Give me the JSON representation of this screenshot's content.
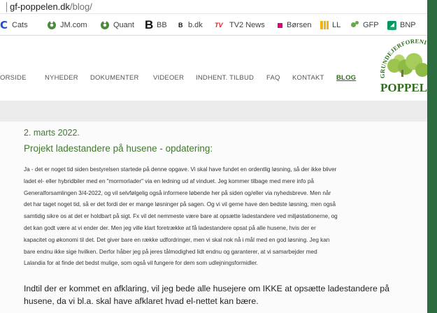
{
  "browser": {
    "url_domain": "gf-poppelen.dk",
    "url_path": "/blog/"
  },
  "bookmarks": [
    {
      "label": "Cats",
      "icon": "c-logo-icon"
    },
    {
      "label": "JM.com",
      "icon": "flower-icon"
    },
    {
      "label": "Quant",
      "icon": "flower-icon"
    },
    {
      "label": "BB",
      "icon": "b-logo-icon"
    },
    {
      "label": "b.dk",
      "icon": "b-logo-icon"
    },
    {
      "label": "TV2 News",
      "icon": "tv2-icon"
    },
    {
      "label": "Børsen",
      "icon": "square-icon"
    },
    {
      "label": "LL",
      "icon": "bars-icon"
    },
    {
      "label": "GFP",
      "icon": "leaf-icon"
    },
    {
      "label": "BNP",
      "icon": "bnp-icon"
    }
  ],
  "nav": {
    "items": [
      "ORSIDE",
      "NYHEDER",
      "DOKUMENTER",
      "VIDEOER",
      "INDHENT. TILBUD",
      "FAQ",
      "KONTAKT",
      "BLOG"
    ],
    "active": "BLOG"
  },
  "logo": {
    "arc_text": "GRUNDEJERFORENI",
    "name": "POPPELEN"
  },
  "post": {
    "date": "2. marts 2022.",
    "title": "Projekt ladestandere på husene - opdatering:",
    "body_lines": [
      "Ja - det er noget tid siden bestyrelsen startede på denne opgave. Vi skal have fundet en ordentlig løsning, så der ikke bliver",
      "ladet el- eller hybridbiler med en \"mormorlader\" via en ledning ud af vinduet. Jeg kommer tilbage med mere info på",
      "Generalforsamlingen 3/4-2022, og vil selvfølgelig også informere løbende her på siden og/eller via nyhedsbreve. Men når",
      "det har taget noget tid, så er det fordi der er mange løsninger på sagen. Og vi vil gerne have den bedste løsning, men også",
      "samtidig sikre os at det er holdbart på sigt. Fx vil det nemmeste være bare at opsætte ladestandere ved miljøstationerne, og",
      "det kan godt være at vi ender der. Men jeg ville klart foretrække at få ladestandere opsat på alle husene, hvis der er",
      "kapacitet og økonomi til det. Det giver bare en række udfordringer, men vi skal nok nå i mål med en god løsning. Jeg kan",
      "bare endnu ikke sige hvilken. Derfor håber jeg på jeres tålmodighed lidt endnu og garanterer, at vi samarbejder med",
      "Lalandia for at finde det bedst mulige, som også vil fungere for dem som udlejningsformidler."
    ],
    "highlight_lines": [
      "Indtil der er kommet en afklaring, vil jeg bede alle husejere om IKKE at opsætte ladestandere på",
      "husene, da vi bl.a. skal have afklaret hvad el-nettet kan bære."
    ]
  },
  "colors": {
    "accent_green": "#3f7a2a",
    "nav_text": "#555555",
    "desktop_green": "#2b6d3f"
  }
}
